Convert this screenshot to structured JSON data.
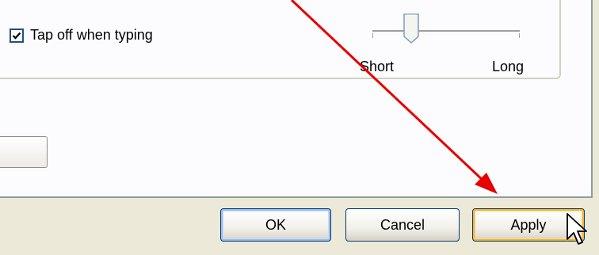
{
  "touchpad": {
    "tap_off_typing": {
      "label": "Tap off when typing",
      "checked": true
    },
    "timeout_slider": {
      "min_label": "Short",
      "max_label": "Long",
      "level": 0.25
    }
  },
  "buttons": {
    "ok_label": "OK",
    "cancel_label": "Cancel",
    "apply_label": "Apply"
  },
  "colors": {
    "annotation_arrow": "#e60000",
    "dialog_background": "#ece9d8",
    "panel_background": "#fcfcfe"
  },
  "icons": [
    "checkmark-icon",
    "slider-thumb-icon",
    "pointer-cursor-icon",
    "annotation-arrow"
  ]
}
